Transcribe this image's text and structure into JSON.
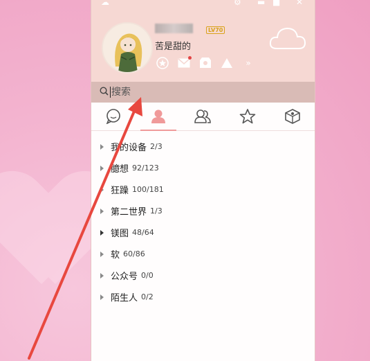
{
  "profile": {
    "status": "苦是甜的",
    "level_badge": "LV70"
  },
  "search": {
    "placeholder": "搜索"
  },
  "tabs": [
    {
      "name": "messages",
      "icon": "chat-bubble-icon"
    },
    {
      "name": "contacts",
      "icon": "person-icon",
      "active": true
    },
    {
      "name": "groups",
      "icon": "group-icon"
    },
    {
      "name": "favorites",
      "icon": "star-icon"
    },
    {
      "name": "apps",
      "icon": "box-icon"
    }
  ],
  "groups": [
    {
      "name": "我的设备",
      "count": "2/3"
    },
    {
      "name": "臆想",
      "count": "92/123"
    },
    {
      "name": "狂躁",
      "count": "100/181"
    },
    {
      "name": "第二世界",
      "count": "1/3"
    },
    {
      "name": "镁图",
      "count": "48/64"
    },
    {
      "name": "软",
      "count": "60/86"
    },
    {
      "name": "公众号",
      "count": "0/0"
    },
    {
      "name": "陌生人",
      "count": "0/2"
    }
  ],
  "colors": {
    "accent": "#f09a9a",
    "header_bg": "#f6d8d3",
    "search_bg": "#d9bbb6",
    "annotation_arrow": "#e8483f"
  }
}
